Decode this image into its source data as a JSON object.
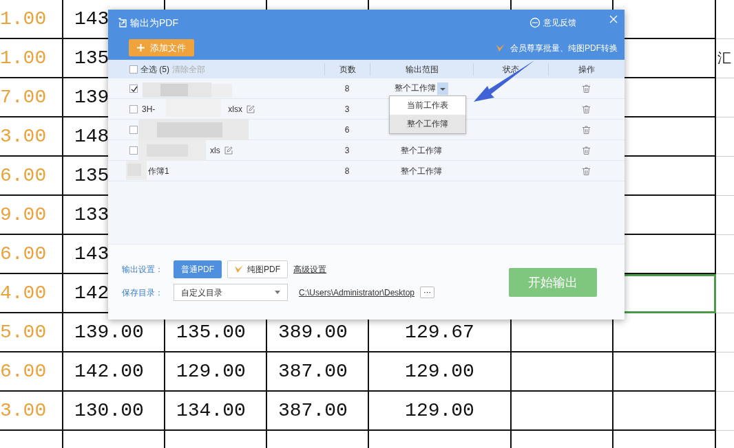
{
  "sheet": {
    "rows": [
      {
        "cells": [
          {
            "text": "1.00",
            "selected": false
          },
          {
            "text": "143",
            "selected": false
          },
          {},
          {},
          {},
          {},
          {
            "selected": false
          },
          {
            "selected": false
          }
        ]
      },
      {
        "cells": [
          {
            "text": "1.00",
            "selected": false
          },
          {
            "text": "135",
            "selected": false
          },
          {},
          {},
          {},
          {},
          {
            "selected": false
          },
          {
            "text": "汇",
            "selected": false
          }
        ]
      },
      {
        "cells": [
          {
            "text": "7.00",
            "selected": false
          },
          {
            "text": "139",
            "selected": false
          },
          {},
          {},
          {},
          {},
          {
            "selected": false
          },
          {
            "selected": false
          }
        ]
      },
      {
        "cells": [
          {
            "text": "3.00",
            "selected": false
          },
          {
            "text": "148",
            "selected": false
          },
          {},
          {},
          {},
          {},
          {
            "selected": false
          },
          {
            "selected": false
          }
        ]
      },
      {
        "cells": [
          {
            "text": "6.00",
            "selected": false
          },
          {
            "text": "135",
            "selected": false
          },
          {},
          {},
          {},
          {},
          {
            "selected": false
          },
          {
            "selected": false
          }
        ]
      },
      {
        "cells": [
          {
            "text": "9.00",
            "selected": false
          },
          {
            "text": "133",
            "selected": false
          },
          {},
          {},
          {},
          {},
          {
            "selected": false
          },
          {
            "selected": false
          }
        ]
      },
      {
        "cells": [
          {
            "text": "6.00",
            "selected": false
          },
          {
            "text": "143",
            "selected": false
          },
          {},
          {},
          {},
          {},
          {
            "selected": false
          },
          {
            "selected": false
          }
        ]
      },
      {
        "cells": [
          {
            "text": "4.00",
            "selected": false
          },
          {
            "text": "142",
            "selected": false
          },
          {},
          {},
          {},
          {},
          {
            "selected": true
          },
          {
            "selected": false
          }
        ]
      },
      {
        "cells": [
          {
            "text": "5.00",
            "selected": false
          },
          {
            "text": "139.00",
            "selected": false
          },
          {
            "text": "135.00",
            "selected": false
          },
          {
            "text": "389.00",
            "selected": false
          },
          {
            "text": "129.67",
            "selected": false
          },
          {
            "selected": false
          },
          {
            "selected": false
          },
          {
            "selected": false
          }
        ]
      },
      {
        "cells": [
          {
            "text": "6.00",
            "selected": false
          },
          {
            "text": "142.00",
            "selected": false
          },
          {
            "text": "129.00",
            "selected": false
          },
          {
            "text": "387.00",
            "selected": false
          },
          {
            "text": "129.00",
            "selected": false
          },
          {
            "selected": false
          },
          {
            "selected": false
          },
          {
            "selected": false
          }
        ]
      },
      {
        "cells": [
          {
            "text": "3.00",
            "selected": false
          },
          {
            "text": "130.00",
            "selected": false
          },
          {
            "text": "134.00",
            "selected": false
          },
          {
            "text": "387.00",
            "selected": false
          },
          {
            "text": "129.00",
            "selected": false
          },
          {
            "selected": false
          },
          {
            "selected": false
          },
          {
            "selected": false
          }
        ]
      },
      {
        "cells": [
          {
            "selected": false
          },
          {
            "selected": false
          },
          {
            "selected": false
          },
          {
            "selected": false
          },
          {
            "selected": false
          },
          {
            "selected": false
          },
          {
            "selected": false
          },
          {}
        ]
      }
    ]
  },
  "dialog": {
    "title": "输出为PDF",
    "feedback": "意见反馈",
    "add_button": "添加文件",
    "promo": "会员尊享批量、纯图PDF转换",
    "select_all": {
      "label": "全选 (5)",
      "checked": false
    },
    "clear_all": "清除全部",
    "columns": [
      "页数",
      "输出范围",
      "状态",
      "操作"
    ],
    "files": [
      {
        "checked": true,
        "pages": "8",
        "range": "整个工作簿",
        "renamable": false,
        "expanded": true,
        "menu": [
          {
            "label": "当前工作表",
            "selected": false
          },
          {
            "label": "整个工作簿",
            "selected": true
          }
        ]
      },
      {
        "checked": false,
        "name_parts": [
          "3H-",
          "xlsx"
        ],
        "pages": "3",
        "renamable": true,
        "expanded": false
      },
      {
        "checked": false,
        "pages": "6",
        "expanded": false
      },
      {
        "checked": false,
        "name_parts": [
          "xls"
        ],
        "pages": "3",
        "range": "整个工作簿",
        "renamable": true,
        "expanded": false
      },
      {
        "name_parts": [
          "作簿1"
        ],
        "pages": "8",
        "range": "整个工作簿",
        "renamable": false,
        "expanded": false
      }
    ],
    "output_label": "输出设置：",
    "modes": [
      {
        "label": "普通PDF",
        "selected": true,
        "vip": false
      },
      {
        "label": "纯图PDF",
        "selected": false,
        "vip": true
      }
    ],
    "advanced": "高级设置",
    "save_label": "保存目录：",
    "directory": "自定义目录",
    "path": "C:\\Users\\Administrator\\Desktop",
    "more": "···",
    "start_button": {
      "label": "开始输出",
      "disabled": true
    }
  }
}
